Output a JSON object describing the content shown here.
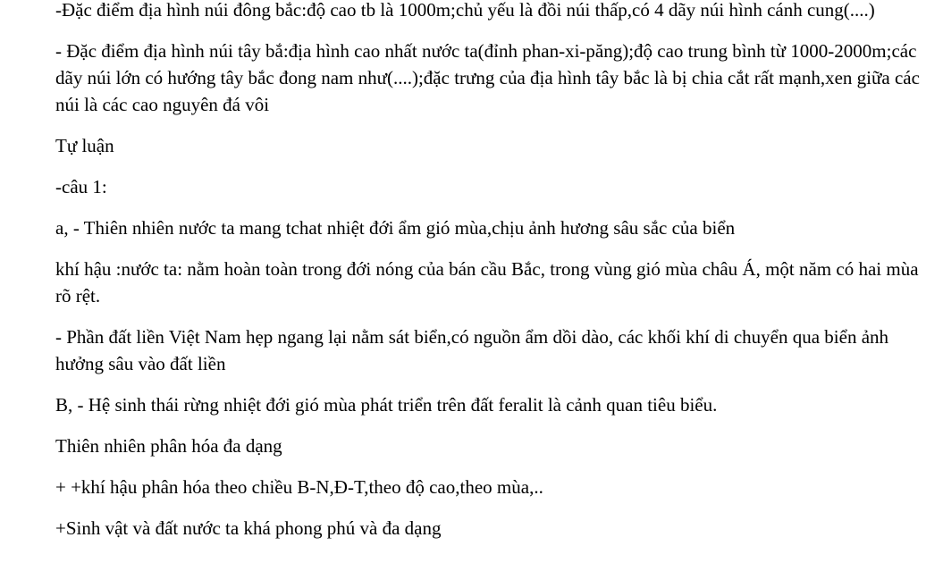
{
  "paragraphs": [
    "-Đặc điểm địa hình núi đông bắc:độ cao tb là 1000m;chủ yếu là đồi núi thấp,có 4 dãy núi hình cánh cung(....)",
    "- Đặc điểm địa hình núi tây  bắ:địa hình cao nhất nước ta(đỉnh phan-xi-păng);độ cao trung bình từ 1000-2000m;các dãy núi lớn có hướng tây bắc đong nam như(....);đặc trưng của địa hình tây bắc là bị chia cắt rất mạnh,xen giữa các núi là các cao nguyên đá vôi",
    "Tự luận",
    "-câu 1:",
    "a, - Thiên nhiên nước ta mang tchat nhiệt đới ẩm gió mùa,chịu ảnh hương sâu sắc của biển",
    "khí hậu :nước ta: nằm hoàn toàn trong đới nóng của bán cầu Bắc, trong vùng gió mùa châu Á, một năm có hai mùa rõ rệt.",
    "- Phần đất liền Việt Nam hẹp ngang lại nằm sát biển,có nguồn ẩm dồi dào, các khối khí di chuyển qua biển ảnh hưởng sâu vào đất liền",
    "B, - Hệ sinh thái rừng nhiệt đới gió mùa phát triển trên đất feralit là cảnh quan tiêu biểu.",
    "Thiên nhiên phân hóa đa dạng",
    "+ +khí hậu phân hóa theo chiều B-N,Đ-T,theo độ cao,theo mùa,..",
    "+Sinh vật và đất nước ta khá phong phú và đa dạng"
  ]
}
